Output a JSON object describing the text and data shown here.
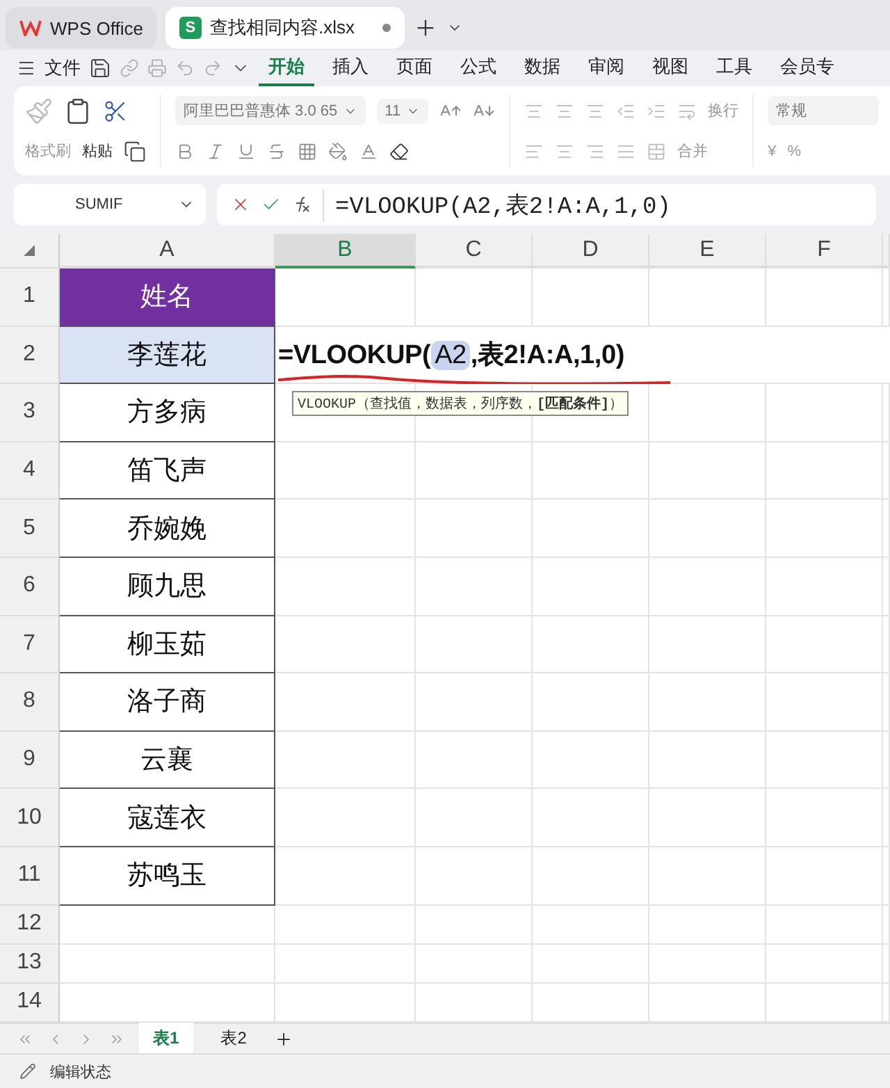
{
  "window_tabs": [
    {
      "label": "WPS Office",
      "selected": false,
      "kind": "home"
    },
    {
      "label": "查找相同内容.xlsx",
      "selected": true,
      "kind": "file",
      "badge": "S"
    }
  ],
  "menu": {
    "file": "文件",
    "tabs": [
      {
        "label": "开始",
        "selected": true
      },
      {
        "label": "插入",
        "selected": false
      },
      {
        "label": "页面",
        "selected": false
      },
      {
        "label": "公式",
        "selected": false
      },
      {
        "label": "数据",
        "selected": false
      },
      {
        "label": "审阅",
        "selected": false
      },
      {
        "label": "视图",
        "selected": false
      },
      {
        "label": "工具",
        "selected": false
      },
      {
        "label": "会员专",
        "selected": false
      }
    ]
  },
  "ribbon": {
    "format_painter": "格式刷",
    "paste": "粘贴",
    "font_name": "阿里巴巴普惠体 3.0 65",
    "font_size": "11",
    "wrap": "换行",
    "merge": "合并",
    "number_format": "常规",
    "currency": "¥",
    "percent": "%"
  },
  "formula_bar": {
    "name_box": "SUMIF",
    "formula": "=VLOOKUP(A2,表2!A:A,1,0)"
  },
  "columns": [
    {
      "label": "A",
      "selected": false
    },
    {
      "label": "B",
      "selected": true
    },
    {
      "label": "C",
      "selected": false
    },
    {
      "label": "D",
      "selected": false
    },
    {
      "label": "E",
      "selected": false
    },
    {
      "label": "F",
      "selected": false
    }
  ],
  "rows": [
    {
      "number": "1",
      "kind": "header",
      "value": "姓名"
    },
    {
      "number": "2",
      "kind": "editing",
      "value": "李莲花",
      "highlighted": true
    },
    {
      "number": "3",
      "kind": "name",
      "value": "方多病"
    },
    {
      "number": "4",
      "kind": "name",
      "value": "笛飞声"
    },
    {
      "number": "5",
      "kind": "name",
      "value": "乔婉娩"
    },
    {
      "number": "6",
      "kind": "name",
      "value": "顾九思"
    },
    {
      "number": "7",
      "kind": "name",
      "value": "柳玉茹"
    },
    {
      "number": "8",
      "kind": "name",
      "value": "洛子商"
    },
    {
      "number": "9",
      "kind": "name",
      "value": "云襄"
    },
    {
      "number": "10",
      "kind": "name",
      "value": "寇莲衣"
    },
    {
      "number": "11",
      "kind": "name",
      "value": "苏鸣玉"
    },
    {
      "number": "12",
      "kind": "empty"
    },
    {
      "number": "13",
      "kind": "empty"
    },
    {
      "number": "14",
      "kind": "empty"
    }
  ],
  "cell_editor": {
    "prefix": "=VLOOKUP(",
    "ref": "A2",
    "suffix": ",表2!A:A,1,0)"
  },
  "tooltip": "VLOOKUP（查找值，数据表，列序数，**[匹配条件]**）",
  "sheet_tabs": [
    {
      "label": "表1",
      "selected": true
    },
    {
      "label": "表2",
      "selected": false
    }
  ],
  "status": "编辑状态"
}
